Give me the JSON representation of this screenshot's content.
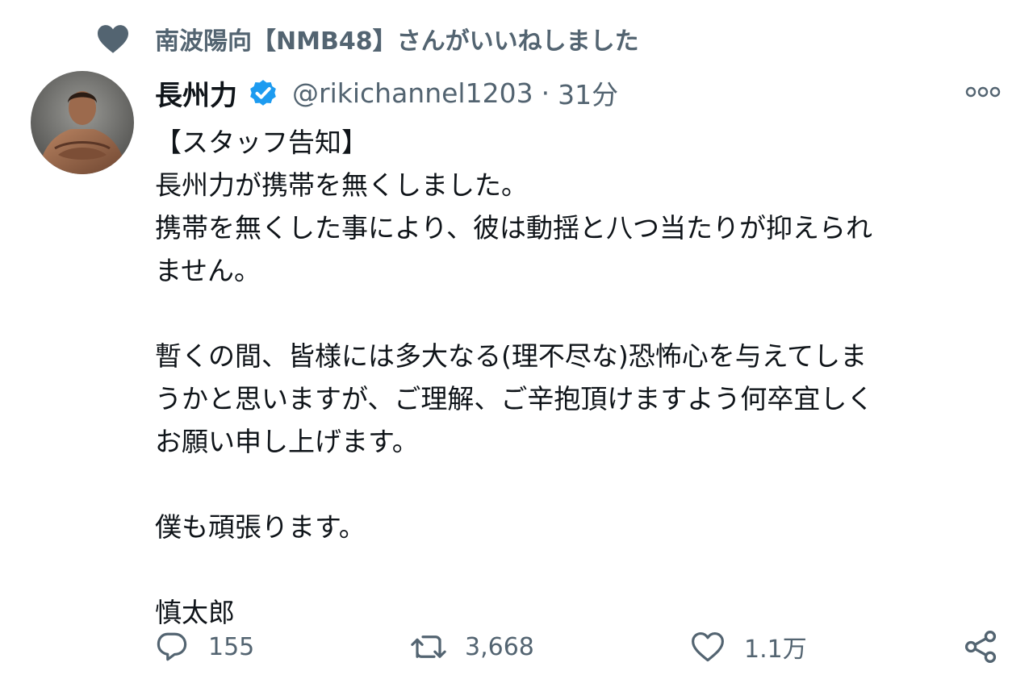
{
  "social_context": {
    "icon": "heart-icon",
    "text": "南波陽向【NMB48】さんがいいねしました"
  },
  "author": {
    "name": "長州力",
    "verified": true,
    "handle": "@rikichannel1203",
    "separator": "·",
    "time": "31分"
  },
  "tweet": {
    "lines": [
      "【スタッフ告知】",
      "長州力が携帯を無くしました。",
      "携帯を無くした事により、彼は動揺と八つ当たりが抑えられ",
      "ません。",
      "",
      "暫くの間、皆様には多大なる(理不尽な)恐怖心を与えてしま",
      "うかと思いますが、ご理解、ご辛抱頂けますよう何卒宜しく",
      "お願い申し上げます。",
      "",
      "僕も頑張ります。",
      "",
      "慎太郎"
    ]
  },
  "actions": {
    "reply": {
      "icon": "reply-icon",
      "count": "155"
    },
    "retweet": {
      "icon": "retweet-icon",
      "count": "3,668"
    },
    "like": {
      "icon": "heart-outline-icon",
      "count": "1.1万"
    },
    "share": {
      "icon": "share-icon"
    }
  },
  "colors": {
    "text_primary": "#0f1419",
    "text_secondary": "#536471",
    "verified_blue": "#1d9bf0",
    "heart_gray": "#536471"
  }
}
